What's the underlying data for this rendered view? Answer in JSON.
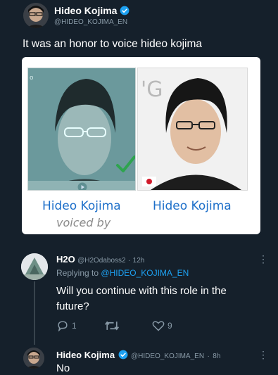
{
  "tweet": {
    "author_name": "Hideo Kojima",
    "author_handle": "@HIDEO_KOJIMA_EN",
    "text": "It was an honor to voice hideo kojima"
  },
  "card": {
    "left_name": "Hideo Kojima",
    "right_name": "Hideo Kojima",
    "voiced_by": "voiced by",
    "partial_text": "'G"
  },
  "reply1": {
    "author_name": "H2O",
    "author_handle": "@H2Odaboss2",
    "separator": "·",
    "time": "12h",
    "replying_prefix": "Replying to",
    "replying_to": "@HIDEO_KOJIMA_EN",
    "text": "Will you continue with this role in the future?",
    "reply_count": "1",
    "retweet_count": "",
    "like_count": "9"
  },
  "reply2": {
    "author_name": "Hideo Kojima",
    "author_handle": "@HIDEO_KOJIMA_EN",
    "separator": "·",
    "time": "8h",
    "text": "No"
  },
  "colors": {
    "background": "#15202b",
    "accent": "#1da1f2",
    "muted": "#8899a6",
    "card_link": "#1d6fc9",
    "check_green": "#2ea44f"
  },
  "icons": [
    "verified-badge-icon",
    "more-options-icon",
    "reply-icon",
    "retweet-icon",
    "like-icon",
    "checkmark-icon",
    "japan-flag-icon",
    "play-icon"
  ]
}
